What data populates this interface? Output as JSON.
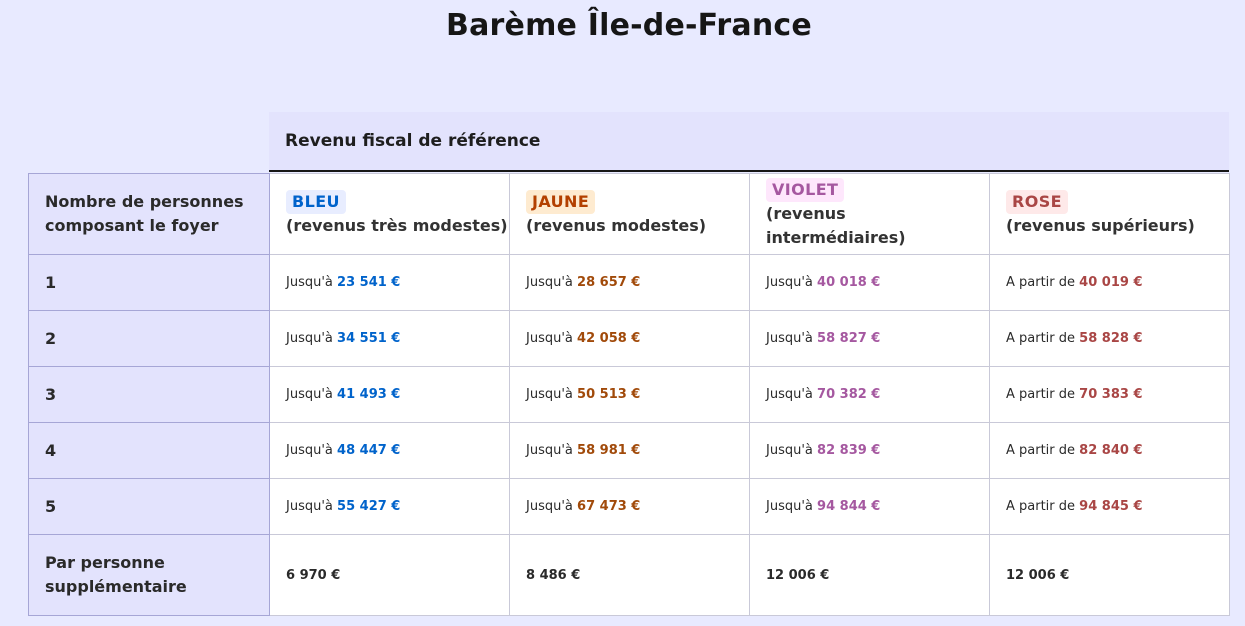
{
  "page": {
    "title": "Barème Île-de-France"
  },
  "table": {
    "group_header": "Revenu fiscal de référence",
    "row_header_label": "Nombre de personnes composant le foyer",
    "columns": [
      {
        "badge": "BLEU",
        "sub": "(revenus très modestes)",
        "prefix": "Jusqu'à",
        "badge_bg": "#e8edff",
        "badge_color": "#0063cb",
        "value_color": "#0063cb"
      },
      {
        "badge": "JAUNE",
        "sub": "(revenus modestes)",
        "prefix": "Jusqu'à",
        "badge_bg": "#feebd0",
        "badge_color": "#b34000",
        "value_color": "#a14a0a"
      },
      {
        "badge": "VIOLET",
        "sub": "(revenus intermédiaires)",
        "prefix": "Jusqu'à",
        "badge_bg": "#fee7fc",
        "badge_color": "#a558a0",
        "value_color": "#a558a0"
      },
      {
        "badge": "ROSE",
        "sub": "(revenus supérieurs)",
        "prefix": "A partir de",
        "badge_bg": "#fee9e9",
        "badge_color": "#a94645",
        "value_color": "#a94645"
      }
    ],
    "rows": [
      {
        "label": "1",
        "values": [
          "23 541 €",
          "28 657 €",
          "40 018 €",
          "40 019 €"
        ]
      },
      {
        "label": "2",
        "values": [
          "34 551 €",
          "42 058 €",
          "58 827 €",
          "58 828 €"
        ]
      },
      {
        "label": "3",
        "values": [
          "41 493 €",
          "50 513 €",
          "70 382 €",
          "70 383 €"
        ]
      },
      {
        "label": "4",
        "values": [
          "48 447 €",
          "58 981 €",
          "82 839 €",
          "82 840 €"
        ]
      },
      {
        "label": "5",
        "values": [
          "55 427 €",
          "67 473 €",
          "94 844 €",
          "94 845 €"
        ]
      }
    ],
    "extra_row": {
      "label": "Par personne supplémentaire",
      "values": [
        "6 970 €",
        "8 486 €",
        "12 006 €",
        "12 006 €"
      ]
    }
  }
}
